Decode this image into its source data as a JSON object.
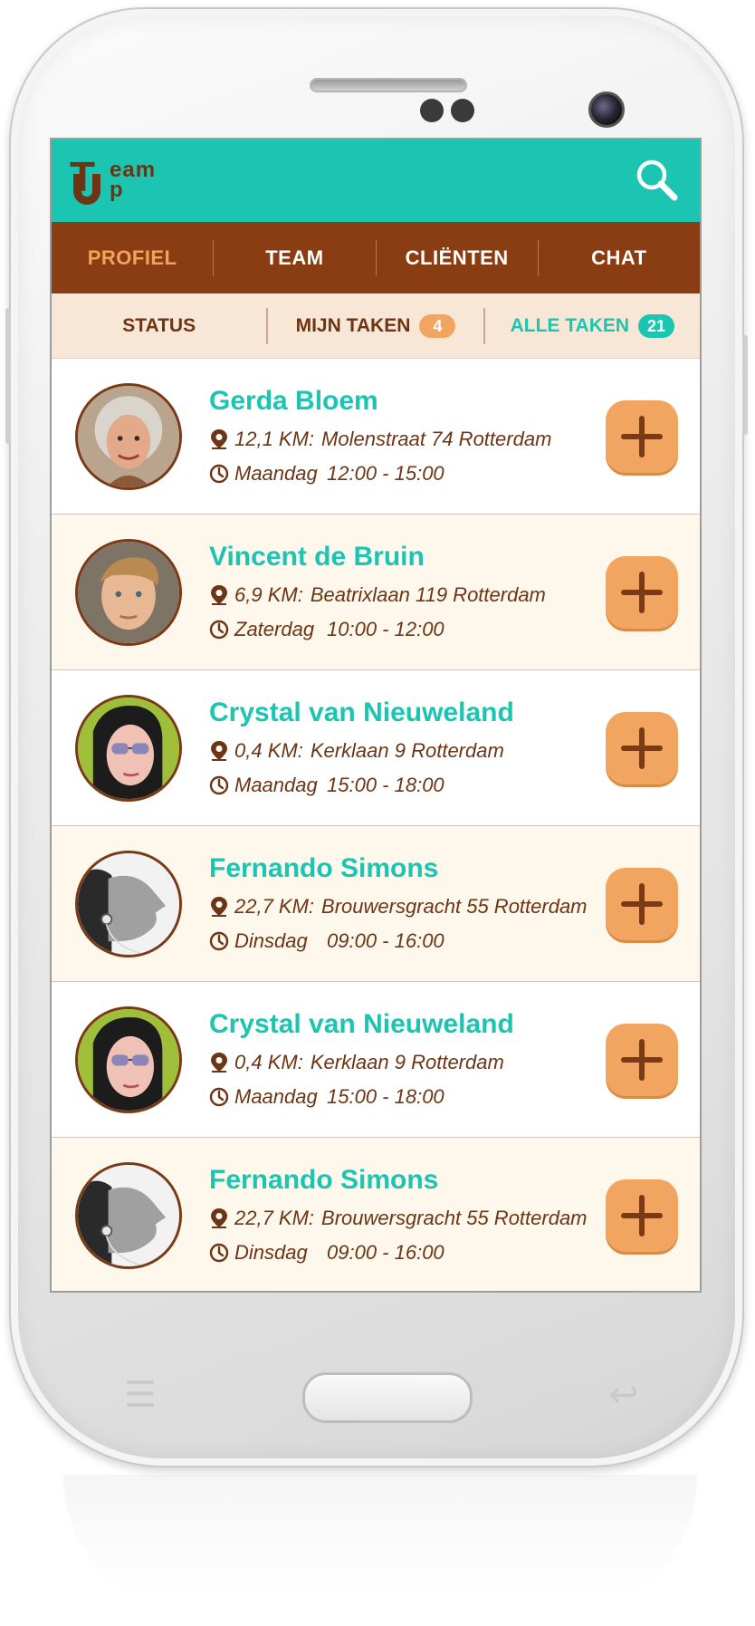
{
  "app": {
    "logo": {
      "letter_t": "T",
      "letter_eam": "eam",
      "letter_p": "p"
    }
  },
  "colors": {
    "primary_teal": "#1cc5b1",
    "brown": "#8a3d13",
    "accent_orange": "#f1a561",
    "beige": "#f8e7d7"
  },
  "tabs": [
    {
      "label": "PROFIEL",
      "active": true
    },
    {
      "label": "TEAM",
      "active": false
    },
    {
      "label": "CLIËNTEN",
      "active": false
    },
    {
      "label": "CHAT",
      "active": false
    }
  ],
  "subtabs": [
    {
      "label": "STATUS",
      "badge": null,
      "active": false
    },
    {
      "label": "MIJN TAKEN",
      "badge": "4",
      "active": false
    },
    {
      "label": "ALLE TAKEN",
      "badge": "21",
      "active": true
    }
  ],
  "tasks": [
    {
      "name": "Gerda Bloem",
      "distance": "12,1 KM:",
      "address": "Molenstraat 74 Rotterdam",
      "day": "Maandag",
      "time": "12:00 - 15:00"
    },
    {
      "name": "Vincent de Bruin",
      "distance": "6,9 KM:",
      "address": "Beatrixlaan 119 Rotterdam",
      "day": "Zaterdag",
      "time": "10:00 - 12:00"
    },
    {
      "name": "Crystal van Nieuweland",
      "distance": "0,4 KM:",
      "address": "Kerklaan 9 Rotterdam",
      "day": "Maandag",
      "time": "15:00 - 18:00"
    },
    {
      "name": "Fernando Simons",
      "distance": "22,7 KM:",
      "address": "Brouwersgracht 55 Rotterdam",
      "day": "Dinsdag",
      "time": "09:00 - 16:00"
    },
    {
      "name": "Crystal van Nieuweland",
      "distance": "0,4 KM:",
      "address": "Kerklaan 9 Rotterdam",
      "day": "Maandag",
      "time": "15:00 - 18:00"
    },
    {
      "name": "Fernando Simons",
      "distance": "22,7 KM:",
      "address": "Brouwersgracht 55 Rotterdam",
      "day": "Dinsdag",
      "time": "09:00 - 16:00"
    }
  ]
}
